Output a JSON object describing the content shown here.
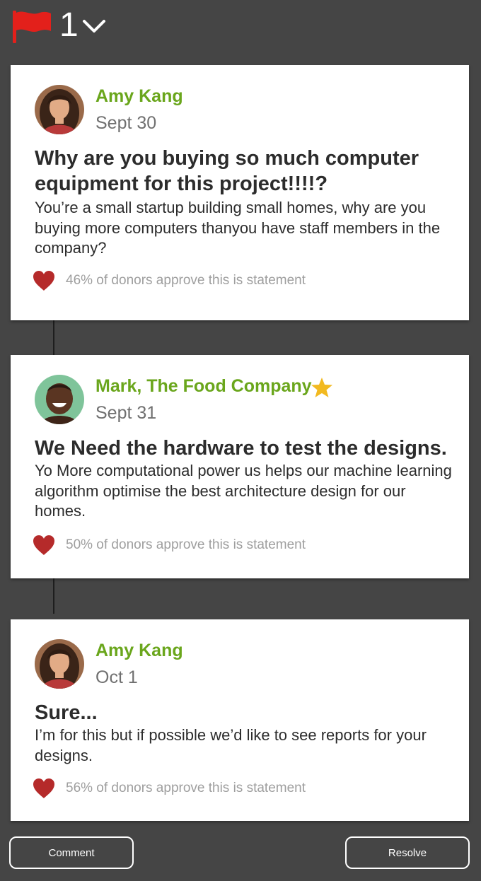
{
  "header": {
    "flag_icon": "flag-icon",
    "flag_count": "1",
    "dropdown_icon": "chevron-down-icon",
    "flag_color": "#e3201b"
  },
  "colors": {
    "author": "#6aa61c",
    "heart": "#b52a2a",
    "star": "#f2b920",
    "background": "#454545"
  },
  "comments": [
    {
      "author": "Amy Kang",
      "date": "Sept 30",
      "title": "Why are you buying so much computer equipment for this project!!!!?",
      "body": "You’re a small startup building small homes, why are you buying more computers thanyou have staff members in the company?",
      "approval": "46% of donors approve this is statement",
      "verified": false
    },
    {
      "author": "Mark, The Food Company",
      "date": "Sept 31",
      "title": "We Need the hardware to test the designs.",
      "body": "Yo More computational power us helps our machine learning algorithm optimise the best architecture design for our homes.",
      "approval": "50% of donors approve this is statement",
      "verified": true
    },
    {
      "author": "Amy Kang",
      "date": "Oct 1",
      "title": "Sure...",
      "body": "I’m for this but if possible we’d like to see reports for your designs.",
      "approval": "56% of donors approve this is statement",
      "verified": false
    }
  ],
  "actions": {
    "comment_label": "Comment",
    "resolve_label": "Resolve"
  }
}
